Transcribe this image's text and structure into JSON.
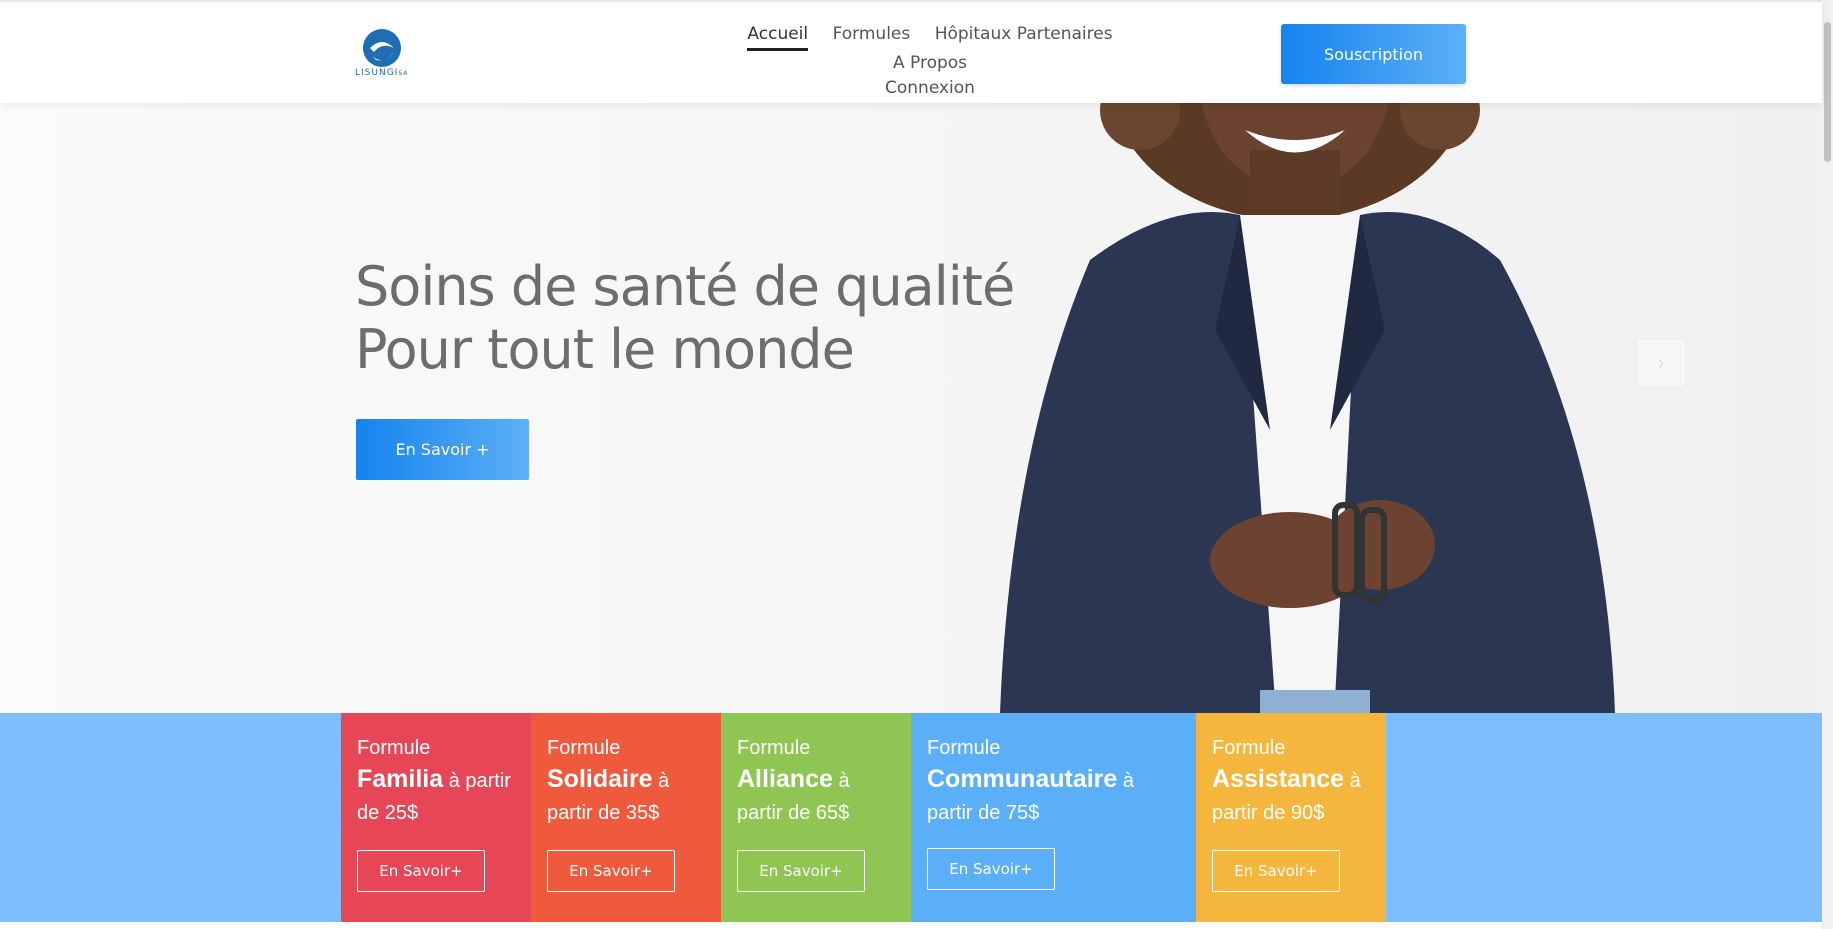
{
  "brand": {
    "logo_text": "LISUNGI",
    "logo_suffix": "SA"
  },
  "nav": {
    "items": [
      "Accueil",
      "Formules",
      "Hôpitaux Partenaires",
      "A Propos",
      "Connexion"
    ],
    "active": "Accueil",
    "cta": "Souscription"
  },
  "hero": {
    "title_line1": "Soins de santé de qualité",
    "title_line2": "Pour tout le monde",
    "button": "En Savoir +"
  },
  "formulas": [
    {
      "label": "Formule",
      "name": "Familia",
      "from": "à partir",
      "price": "de 25$",
      "button": "En Savoir+",
      "color": "#e64656"
    },
    {
      "label": "Formule",
      "name": "Solidaire",
      "from": "à",
      "price": "partir de 35$",
      "button": "En Savoir+",
      "color": "#f05a3c"
    },
    {
      "label": "Formule",
      "name": "Alliance",
      "from": "à",
      "price": "partir de 65$",
      "button": "En Savoir+",
      "color": "#8fc552"
    },
    {
      "label": "Formule",
      "name": "Communautaire",
      "from": "à",
      "price": "partir de 75$",
      "button": "En Savoir+",
      "color": "#5aaff8"
    },
    {
      "label": "Formule",
      "name": "Assistance",
      "from": "à",
      "price": "partir de 90$",
      "button": "En Savoir+",
      "color": "#f4b63d"
    }
  ],
  "colors": {
    "band": "#7dbefc",
    "accent": "#1583ef"
  }
}
